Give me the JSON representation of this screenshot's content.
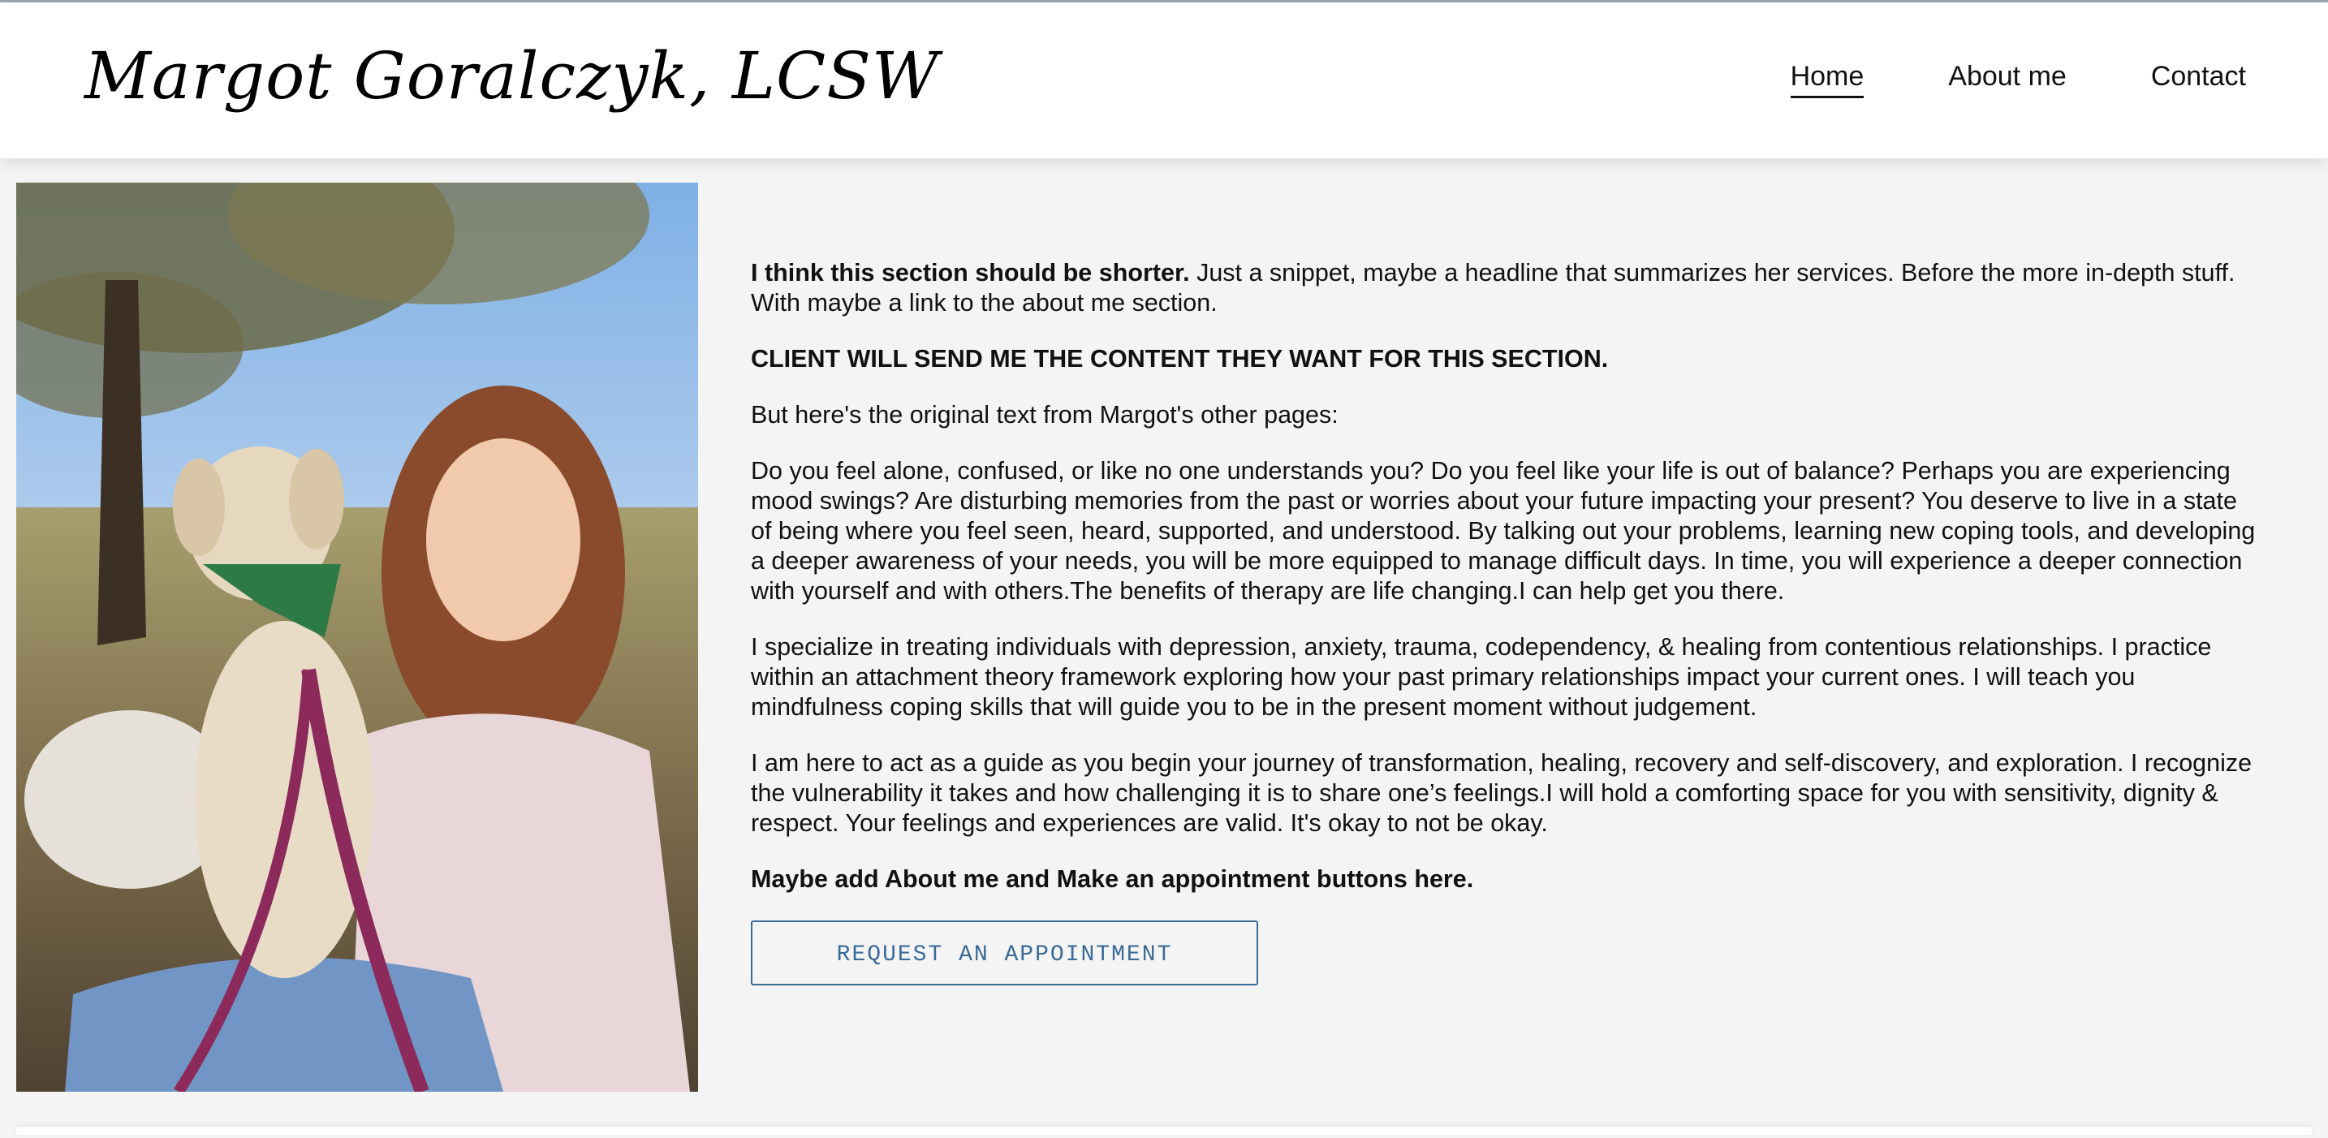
{
  "header": {
    "brand": "Margot Goralczyk, LCSW",
    "nav": [
      {
        "label": "Home"
      },
      {
        "label": "About me"
      },
      {
        "label": "Contact"
      }
    ]
  },
  "main": {
    "intro_bold": "I think this section should be shorter.",
    "intro_rest": " Just a snippet, maybe a headline that summarizes her services. Before the more in-depth stuff. With maybe a link to the about me section.",
    "note_client": "CLIENT WILL SEND ME THE CONTENT THEY WANT FOR THIS SECTION.",
    "original_text_lead": "But here's the original text from Margot's other pages:",
    "paragraph_1": "Do you feel alone, confused, or like no one understands you? Do you feel like your life is out of balance? Perhaps you are experiencing mood swings? Are disturbing memories from the past or worries about your future impacting your present? You deserve to live in a state of being where you feel seen, heard, supported, and understood. By talking out your problems, learning new coping tools, and developing a deeper awareness of your needs, you will be more equipped to manage difficult days. In time, you will experience a deeper connection with yourself and with others.The benefits of therapy are life changing.I can help get you there.",
    "paragraph_2": "I specialize in treating individuals with depression, anxiety, trauma, codependency, & healing from contentious relationships. I practice within an attachment theory framework exploring how your past primary relationships impact your current ones. I will teach you mindfulness coping skills that will guide you to be in the present moment without judgement.",
    "paragraph_3": "I am here to act as a guide as you begin your journey of transformation, healing, recovery and self-discovery, and exploration. I recognize the vulnerability it takes and how challenging it is to share one’s feelings.I will hold a comforting space for you with sensitivity, dignity & respect. Your feelings and experiences are valid. It's okay to not be okay.",
    "note_buttons": "Maybe add About me and Make an appointment buttons here.",
    "cta_label": "REQUEST AN APPOINTMENT"
  },
  "colors": {
    "background": "#f4f4f4",
    "header_bg": "#ffffff",
    "cta_accent": "#3a6a96",
    "text": "#111111"
  }
}
